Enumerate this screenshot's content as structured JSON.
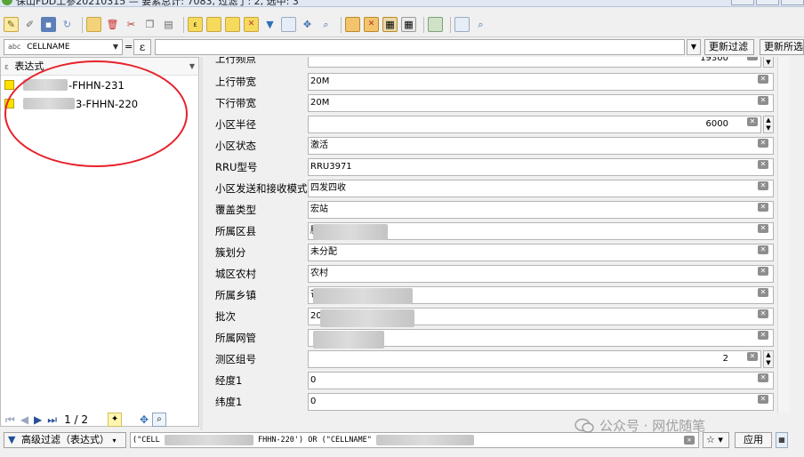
{
  "window": {
    "title": "保山FDD工参20210315 — 要素总计: 7083, 过滤了: 2, 选中: 3"
  },
  "filter_row": {
    "field_type_hint": "abc",
    "field_name": "CELLNAME",
    "operator": "=",
    "expression_symbol": "ε",
    "value": "",
    "update_filter_label": "更新过滤",
    "update_new_filter_label": "更新所选"
  },
  "left_panel": {
    "header": "表达式",
    "features": [
      {
        "label": "-FHHN-231"
      },
      {
        "label": "3-FHHN-220"
      }
    ],
    "page_indicator": "1 / 2"
  },
  "form": {
    "rows": [
      {
        "label": "上行频点",
        "value": "19300",
        "spin": true
      },
      {
        "label": "上行带宽",
        "value": "20M"
      },
      {
        "label": "下行带宽",
        "value": "20M"
      },
      {
        "label": "小区半径",
        "value": "6000",
        "spin": true
      },
      {
        "label": "小区状态",
        "value": "激活"
      },
      {
        "label": "RRU型号",
        "value": "RRU3971"
      },
      {
        "label": "小区发送和接收模式",
        "value": "四发四收"
      },
      {
        "label": "覆盖类型",
        "value": "宏站"
      },
      {
        "label": "所属区县",
        "value": "腾"
      },
      {
        "label": "簇划分",
        "value": "未分配"
      },
      {
        "label": "城区农村",
        "value": "农村"
      },
      {
        "label": "所属乡镇",
        "value": "芒"
      },
      {
        "label": "批次",
        "value": "20"
      },
      {
        "label": "所属网管",
        "value": ""
      },
      {
        "label": "测区组号",
        "value": "2",
        "spin": true
      },
      {
        "label": "经度1",
        "value": "0"
      },
      {
        "label": "纬度1",
        "value": "0"
      }
    ],
    "clear_symbol": "⌫"
  },
  "bottom_bar": {
    "filter_mode_label": "高级过滤（表达式）",
    "expression_text": "(\"CELL",
    "expression_tail": "FHHN-220') OR (\"CELLNAME\"",
    "apply_label": "应用"
  },
  "watermark": {
    "text": "公众号 · 网优随笔"
  },
  "colors": {
    "feature_swatch": "#ffe100",
    "annotation_ellipse": "#e8202a",
    "nav_active": "#2a4f9a"
  },
  "icons": [
    "edit-pencil-icon",
    "toggle-edit-icon",
    "save-icon",
    "reload-icon",
    "add-feature-icon",
    "delete-icon",
    "cut-icon",
    "copy-icon",
    "paste-icon",
    "select-by-expression-icon",
    "select-all-icon",
    "invert-selection-icon",
    "deselect-icon",
    "filter-icon",
    "move-selection-top-icon",
    "pan-to-icon",
    "zoom-to-icon",
    "new-field-icon",
    "delete-field-icon",
    "field-calculator-icon",
    "conditional-formatting-icon",
    "actions-icon",
    "dock-icon",
    "help-icon"
  ]
}
